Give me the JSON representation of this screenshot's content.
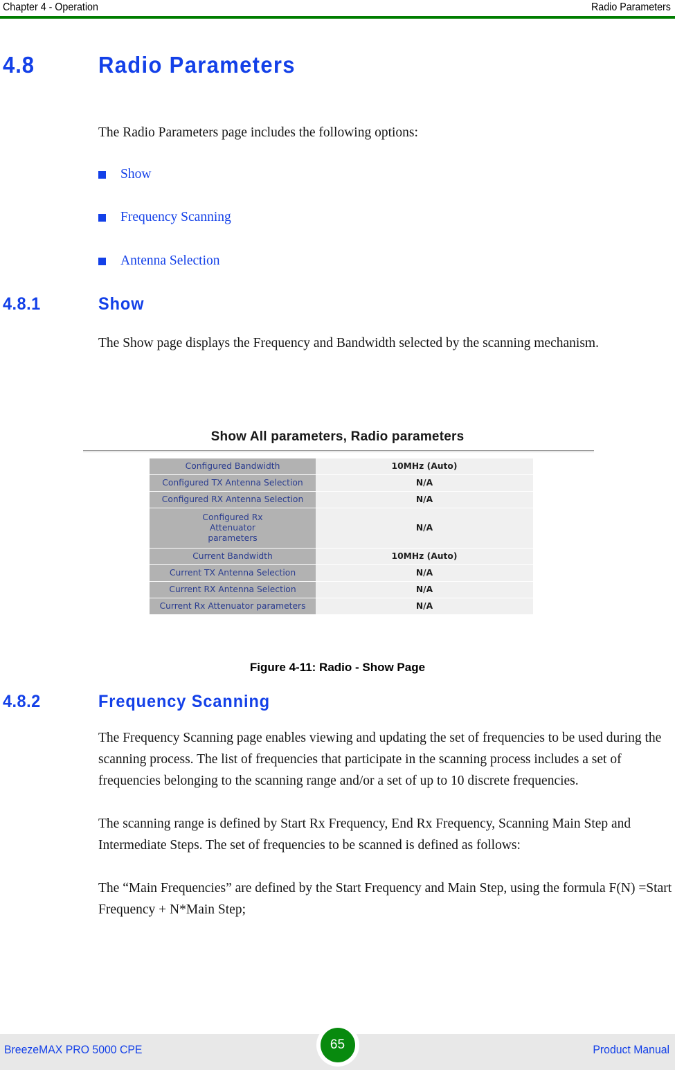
{
  "header": {
    "left": "Chapter 4 - Operation",
    "right": "Radio Parameters",
    "rule_color": "#007d00"
  },
  "section_48": {
    "number": "4.8",
    "title": "Radio Parameters",
    "intro": "The Radio Parameters page includes the following options:",
    "options": [
      {
        "label": "Show"
      },
      {
        "label": "Frequency Scanning"
      },
      {
        "label": "Antenna Selection"
      }
    ]
  },
  "section_481": {
    "number": "4.8.1",
    "title": "Show",
    "paragraph": "The Show page displays the Frequency and Bandwidth selected by the scanning mechanism."
  },
  "figure": {
    "title": "Show All parameters, Radio parameters",
    "caption": "Figure 4-11: Radio - Show Page",
    "label_color": "#2a3c8f",
    "label_bg": "#b2b2b2",
    "value_bg": "#f0f0f0",
    "rows": [
      {
        "label": "Configured Bandwidth",
        "value": "10MHz (Auto)"
      },
      {
        "label": "Configured TX Antenna Selection",
        "value": "N/A"
      },
      {
        "label": "Configured RX Antenna Selection",
        "value": "N/A"
      },
      {
        "label": "Configured Rx Attenuator parameters",
        "value": "N/A"
      },
      {
        "label": "Current Bandwidth",
        "value": "10MHz (Auto)"
      },
      {
        "label": "Current TX Antenna Selection",
        "value": "N/A"
      },
      {
        "label": "Current RX Antenna Selection",
        "value": "N/A"
      },
      {
        "label": "Current Rx Attenuator parameters",
        "value": "N/A"
      }
    ]
  },
  "section_482": {
    "number": "4.8.2",
    "title": "Frequency Scanning",
    "paragraph_1": "The Frequency Scanning page enables viewing and updating the set of frequencies to be used during the scanning process. The list of frequencies that participate in the scanning process includes a set of frequencies belonging to the scanning range and/or a set of up to 10 discrete frequencies.",
    "paragraph_2": "The scanning range is defined by Start Rx Frequency, End Rx Frequency, Scanning Main Step and Intermediate Steps. The set of frequencies to be scanned is defined as follows:",
    "paragraph_3": "The “Main Frequencies” are defined by the Start Frequency and Main Step, using the formula F(N) =Start Frequency + N*Main Step;"
  },
  "footer": {
    "left": "BreezeMAX PRO 5000 CPE",
    "page_number": "65",
    "right": "Product Manual",
    "badge_color": "#088a0e",
    "band_color": "#e8e8e8"
  }
}
